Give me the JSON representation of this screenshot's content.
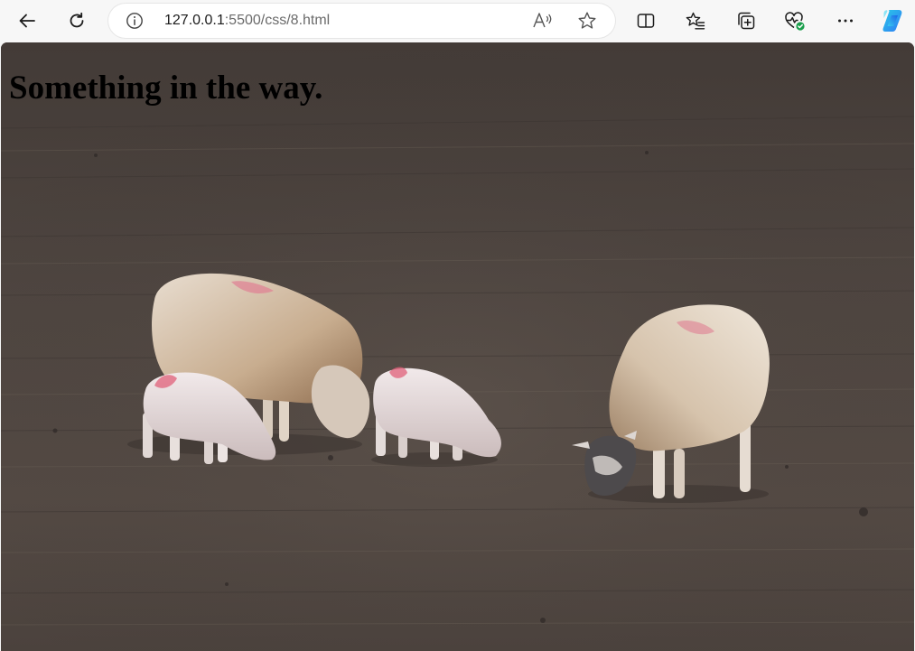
{
  "browser": {
    "url_host": "127.0.0.1",
    "url_rest": ":5500/css/8.html"
  },
  "page": {
    "heading": "Something in the way."
  },
  "icons": {
    "back": "back-arrow-icon",
    "refresh": "refresh-icon",
    "site_info": "info-icon",
    "read_aloud": "read-aloud-icon",
    "favorite": "star-icon",
    "split_screen": "split-screen-icon",
    "favorites": "favorites-list-icon",
    "collections": "collections-icon",
    "browser_essentials": "heart-pulse-icon",
    "more": "more-dots-icon",
    "copilot": "copilot-icon"
  },
  "colors": {
    "toolbar_bg": "#f7f7f7",
    "field": "#4e4540",
    "heading_text": "#000000",
    "essentials_badge": "#1a9e4b",
    "copilot_a": "#2f7bf5",
    "copilot_b": "#29c9e8"
  }
}
